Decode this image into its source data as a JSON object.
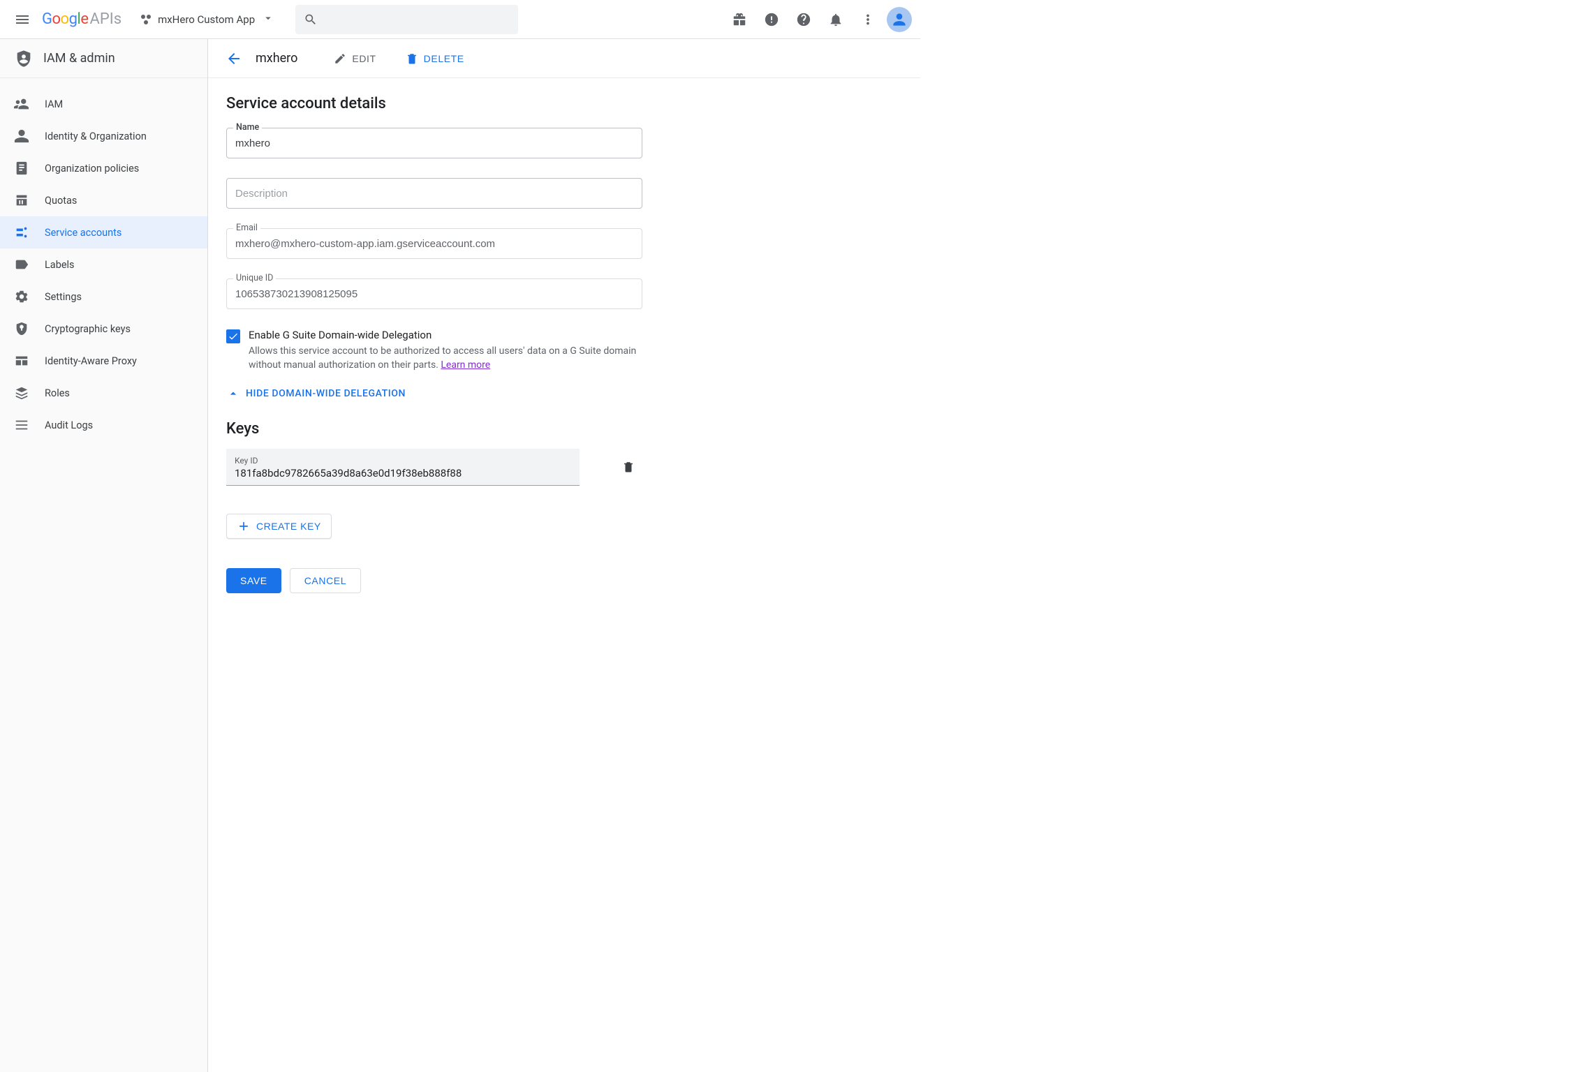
{
  "header": {
    "logo_text_apis": "APIs",
    "project_name": "mxHero Custom App",
    "search_placeholder": ""
  },
  "sidebar": {
    "title": "IAM & admin",
    "items": [
      {
        "label": "IAM",
        "icon": "iam"
      },
      {
        "label": "Identity & Organization",
        "icon": "identity"
      },
      {
        "label": "Organization policies",
        "icon": "policies"
      },
      {
        "label": "Quotas",
        "icon": "quotas"
      },
      {
        "label": "Service accounts",
        "icon": "service-accounts",
        "active": true
      },
      {
        "label": "Labels",
        "icon": "labels"
      },
      {
        "label": "Settings",
        "icon": "settings"
      },
      {
        "label": "Cryptographic keys",
        "icon": "crypto"
      },
      {
        "label": "Identity-Aware Proxy",
        "icon": "iap"
      },
      {
        "label": "Roles",
        "icon": "roles"
      },
      {
        "label": "Audit Logs",
        "icon": "audit"
      }
    ]
  },
  "content_header": {
    "title": "mxhero",
    "edit_label": "Edit",
    "delete_label": "Delete"
  },
  "details": {
    "section_title": "Service account details",
    "name_label": "Name",
    "name_value": "mxhero",
    "description_placeholder": "Description",
    "email_label": "Email",
    "email_value": "mxhero@mxhero-custom-app.iam.gserviceaccount.com",
    "unique_id_label": "Unique ID",
    "unique_id_value": "106538730213908125095",
    "delegation": {
      "checked": true,
      "label": "Enable G Suite Domain-wide Delegation",
      "desc": "Allows this service account to be authorized to access all users' data on a G Suite domain without manual authorization on their parts. ",
      "learn_more": "Learn more"
    },
    "toggle_label": "Hide domain-wide delegation"
  },
  "keys": {
    "section_title": "Keys",
    "key_id_label": "Key ID",
    "key_id_value": "181fa8bdc9782665a39d8a63e0d19f38eb888f88",
    "create_key_label": "Create key"
  },
  "footer": {
    "save_label": "Save",
    "cancel_label": "Cancel"
  }
}
